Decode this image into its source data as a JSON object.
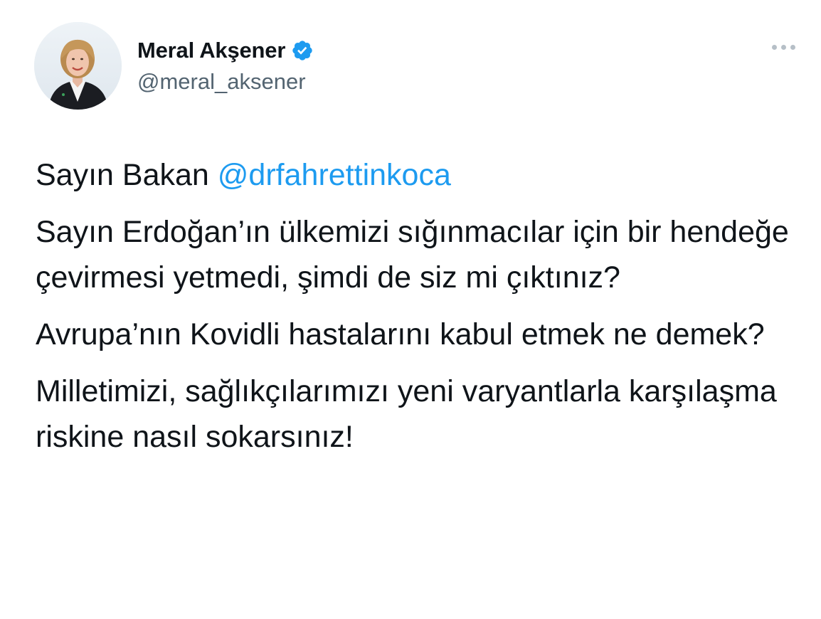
{
  "tweet": {
    "author": {
      "display_name": "Meral Akşener",
      "handle": "@meral_aksener",
      "verified": true,
      "avatar_icon": "profile-photo"
    },
    "more_icon": "more-dots-icon",
    "text": {
      "line1_prefix": "Sayın Bakan ",
      "mention": "@drfahrettinkoca",
      "para2": "Sayın Erdoğan’ın ülkemizi sığınmacılar için bir hendeğe çevirmesi yetmedi, şimdi de siz mi çıktınız?",
      "para3": "Avrupa’nın Kovidli hastalarını kabul etmek ne demek?",
      "para4": "Milletimizi, sağlıkçılarımızı yeni varyantlarla karşılaşma riskine nasıl sokarsınız!"
    },
    "colors": {
      "mention": "#1d9bf0",
      "verified": "#1d9bf0",
      "handle": "#536471"
    }
  }
}
